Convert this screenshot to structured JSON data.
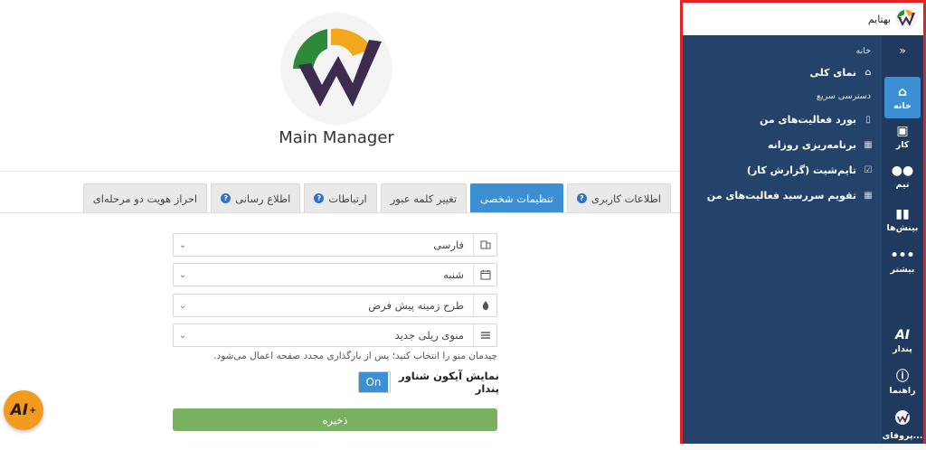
{
  "main": {
    "app_name": "Main Manager",
    "tabs": [
      {
        "label": "اطلاعات کاربری",
        "help": true,
        "active": false
      },
      {
        "label": "تنظیمات شخصی",
        "help": false,
        "active": true
      },
      {
        "label": "تغییر کلمه عبور",
        "help": false,
        "active": false
      },
      {
        "label": "ارتباطات",
        "help": true,
        "active": false
      },
      {
        "label": "اطلاع رسانی",
        "help": true,
        "active": false
      },
      {
        "label": "احراز هویت دو مرحله‌ای",
        "help": false,
        "active": false
      }
    ],
    "fields": {
      "language": "فارسی",
      "week_start": "شنبه",
      "theme": "طرح زمینه پیش فرض",
      "menu_layout": "منوی ریلی جدید"
    },
    "hint": "چیدمان منو را انتخاب کنید؛ پس از بارگذاری مجدد صفحه اعمال می‌شود.",
    "toggle_label": "نمایش آیکون شناور پندار",
    "toggle_state": "On",
    "save_label": "ذخیره",
    "ai_fab_label": "AI",
    "help_glyph": "?"
  },
  "sidebar": {
    "brand_name": "بهتایم",
    "home_section": "خانه",
    "overview": "نمای کلی",
    "quick_access_title": "دسترسی سریع",
    "quick_items": [
      "بورد فعالیت‌های من",
      "برنامه‌ریزی روزانه",
      "تایم‌شیت (گزارش کار)",
      "تقویم سررسید فعالیت‌های من"
    ],
    "collapse_glyph": "»",
    "rail": [
      {
        "label": "خانه"
      },
      {
        "label": "کار"
      },
      {
        "label": "تیم"
      },
      {
        "label": "بینش‌ها"
      },
      {
        "label": "بیشتر"
      },
      {
        "label": "پندار"
      },
      {
        "label": "راهنما"
      },
      {
        "label": "پروفای..."
      }
    ]
  },
  "colors": {
    "accent": "#3d8fd4",
    "sidebar_bg": "#24436a",
    "rail_bg": "#1f3a5e",
    "save_green": "#78b261",
    "ai_orange": "#f39b1f",
    "highlight_red": "#e32222"
  }
}
